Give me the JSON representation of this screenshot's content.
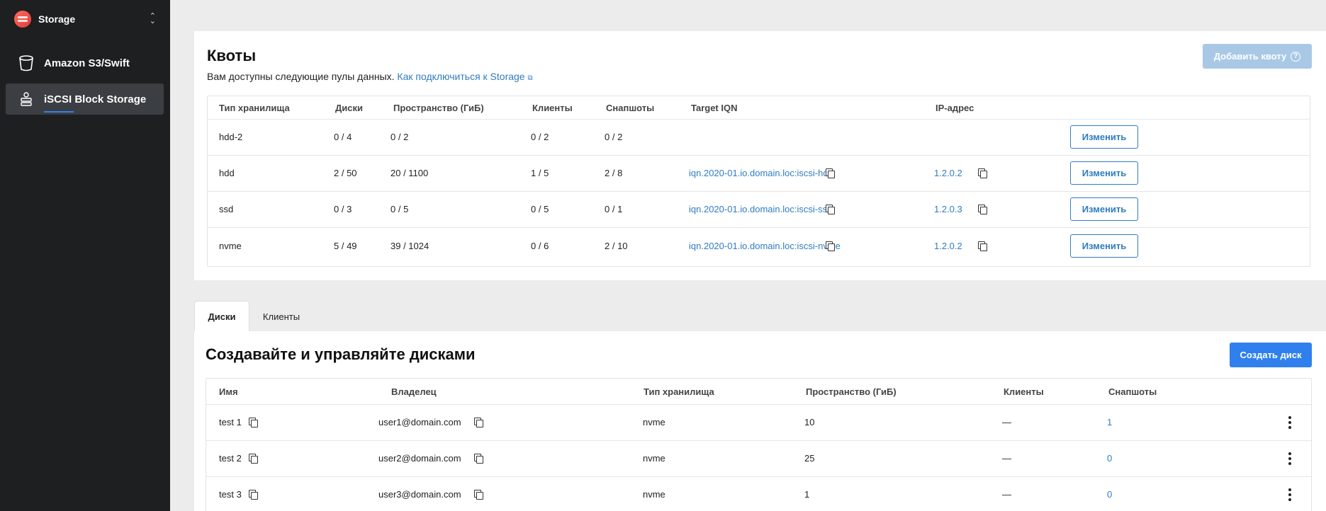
{
  "sidebar": {
    "title": "Storage",
    "items": [
      {
        "label": "Amazon S3/Swift",
        "icon": "bucket-icon"
      },
      {
        "label": "iSCSI Block Storage",
        "icon": "disk-stack-icon",
        "active": true
      }
    ]
  },
  "quotas": {
    "title": "Квоты",
    "subtitle": "Вам доступны следующие пулы данных.",
    "link_text": "Как подключиться к Storage",
    "add_button": "Добавить квоту",
    "columns": [
      "Тип хранилища",
      "Диски",
      "Пространство (ГиБ)",
      "Клиенты",
      "Снапшоты",
      "Target IQN",
      "IP-адрес"
    ],
    "rows": [
      {
        "type": "hdd-2",
        "disks": "0 / 4",
        "space": "0 / 2",
        "clients": "0 / 2",
        "snapshots": "0 / 2",
        "iqn": "",
        "ip": "",
        "action": "Изменить"
      },
      {
        "type": "hdd",
        "disks": "2 / 50",
        "space": "20 / 1100",
        "clients": "1 / 5",
        "snapshots": "2 / 8",
        "iqn": "iqn.2020-01.io.domain.loc:iscsi-hdd",
        "ip": "1.2.0.2",
        "action": "Изменить"
      },
      {
        "type": "ssd",
        "disks": "0 / 3",
        "space": "0 / 5",
        "clients": "0 / 5",
        "snapshots": "0 / 1",
        "iqn": "iqn.2020-01.io.domain.loc:iscsi-ssd",
        "ip": "1.2.0.3",
        "action": "Изменить"
      },
      {
        "type": "nvme",
        "disks": "5 / 49",
        "space": "39 / 1024",
        "clients": "0 / 6",
        "snapshots": "2 / 10",
        "iqn": "iqn.2020-01.io.domain.loc:iscsi-nvme",
        "ip": "1.2.0.2",
        "action": "Изменить"
      }
    ]
  },
  "tabs": [
    {
      "label": "Диски",
      "active": true
    },
    {
      "label": "Клиенты",
      "active": false
    }
  ],
  "disks": {
    "title": "Создавайте и управляйте дисками",
    "create_button": "Создать диск",
    "columns": [
      "Имя",
      "Владелец",
      "Тип хранилища",
      "Пространство (ГиБ)",
      "Клиенты",
      "Снапшоты"
    ],
    "rows": [
      {
        "name": "test 1",
        "owner": "user1@domain.com",
        "type": "nvme",
        "space": "10",
        "clients": "—",
        "snapshots": "1"
      },
      {
        "name": "test 2",
        "owner": "user2@domain.com",
        "type": "nvme",
        "space": "25",
        "clients": "—",
        "snapshots": "0"
      },
      {
        "name": "test 3",
        "owner": "user3@domain.com",
        "type": "nvme",
        "space": "1",
        "clients": "—",
        "snapshots": "0"
      }
    ]
  },
  "colors": {
    "accent": "#2f80ed",
    "link": "#2f7cc2",
    "sidebar": "#1d1f21",
    "disabled_button": "#a8c8e6"
  }
}
